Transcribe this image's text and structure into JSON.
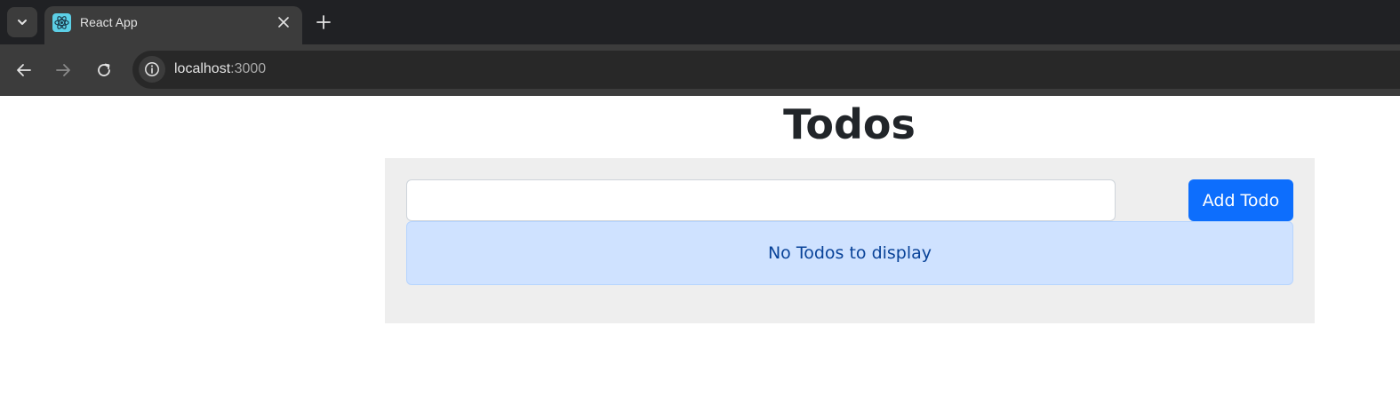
{
  "browser": {
    "tab": {
      "title": "React App",
      "favicon": "react-logo-icon"
    },
    "address_bar": {
      "host": "localhost",
      "port": ":3000"
    },
    "icons": {
      "tab_search": "chevron-down-icon",
      "close_tab": "close-icon",
      "new_tab": "plus-icon",
      "back": "arrow-left-icon",
      "forward": "arrow-right-icon",
      "reload": "reload-icon",
      "site_info": "info-icon"
    }
  },
  "app": {
    "heading": "Todos",
    "input": {
      "value": "",
      "placeholder": ""
    },
    "add_button_label": "Add Todo",
    "empty_message": "No Todos to display"
  },
  "colors": {
    "primary": "#0d6efd",
    "alert_bg": "#cfe2ff",
    "alert_text": "#084298",
    "panel_bg": "#eeeeee"
  }
}
